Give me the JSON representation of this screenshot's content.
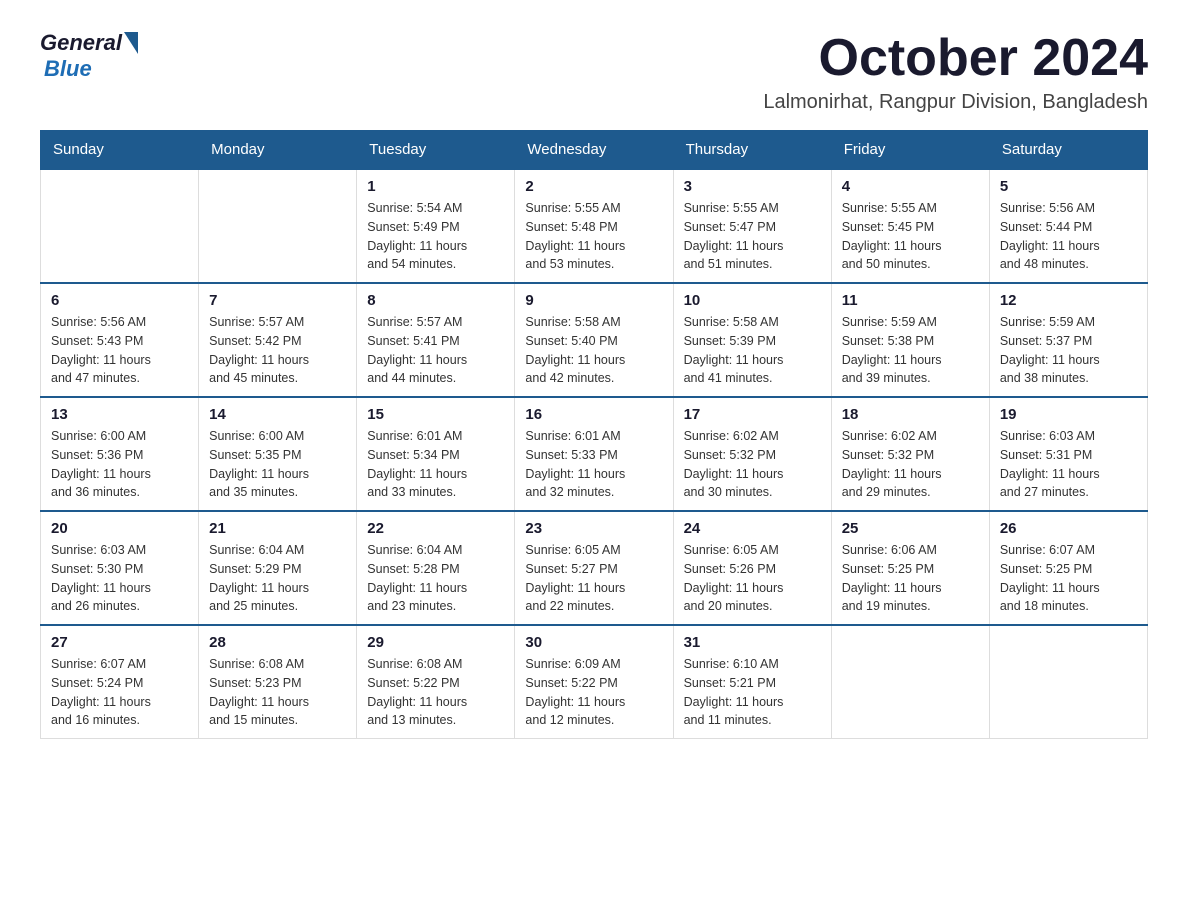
{
  "logo": {
    "text_general": "General",
    "text_blue": "Blue"
  },
  "header": {
    "month_year": "October 2024",
    "location": "Lalmonirhat, Rangpur Division, Bangladesh"
  },
  "weekdays": [
    "Sunday",
    "Monday",
    "Tuesday",
    "Wednesday",
    "Thursday",
    "Friday",
    "Saturday"
  ],
  "weeks": [
    [
      {
        "day": "",
        "info": ""
      },
      {
        "day": "",
        "info": ""
      },
      {
        "day": "1",
        "info": "Sunrise: 5:54 AM\nSunset: 5:49 PM\nDaylight: 11 hours\nand 54 minutes."
      },
      {
        "day": "2",
        "info": "Sunrise: 5:55 AM\nSunset: 5:48 PM\nDaylight: 11 hours\nand 53 minutes."
      },
      {
        "day": "3",
        "info": "Sunrise: 5:55 AM\nSunset: 5:47 PM\nDaylight: 11 hours\nand 51 minutes."
      },
      {
        "day": "4",
        "info": "Sunrise: 5:55 AM\nSunset: 5:45 PM\nDaylight: 11 hours\nand 50 minutes."
      },
      {
        "day": "5",
        "info": "Sunrise: 5:56 AM\nSunset: 5:44 PM\nDaylight: 11 hours\nand 48 minutes."
      }
    ],
    [
      {
        "day": "6",
        "info": "Sunrise: 5:56 AM\nSunset: 5:43 PM\nDaylight: 11 hours\nand 47 minutes."
      },
      {
        "day": "7",
        "info": "Sunrise: 5:57 AM\nSunset: 5:42 PM\nDaylight: 11 hours\nand 45 minutes."
      },
      {
        "day": "8",
        "info": "Sunrise: 5:57 AM\nSunset: 5:41 PM\nDaylight: 11 hours\nand 44 minutes."
      },
      {
        "day": "9",
        "info": "Sunrise: 5:58 AM\nSunset: 5:40 PM\nDaylight: 11 hours\nand 42 minutes."
      },
      {
        "day": "10",
        "info": "Sunrise: 5:58 AM\nSunset: 5:39 PM\nDaylight: 11 hours\nand 41 minutes."
      },
      {
        "day": "11",
        "info": "Sunrise: 5:59 AM\nSunset: 5:38 PM\nDaylight: 11 hours\nand 39 minutes."
      },
      {
        "day": "12",
        "info": "Sunrise: 5:59 AM\nSunset: 5:37 PM\nDaylight: 11 hours\nand 38 minutes."
      }
    ],
    [
      {
        "day": "13",
        "info": "Sunrise: 6:00 AM\nSunset: 5:36 PM\nDaylight: 11 hours\nand 36 minutes."
      },
      {
        "day": "14",
        "info": "Sunrise: 6:00 AM\nSunset: 5:35 PM\nDaylight: 11 hours\nand 35 minutes."
      },
      {
        "day": "15",
        "info": "Sunrise: 6:01 AM\nSunset: 5:34 PM\nDaylight: 11 hours\nand 33 minutes."
      },
      {
        "day": "16",
        "info": "Sunrise: 6:01 AM\nSunset: 5:33 PM\nDaylight: 11 hours\nand 32 minutes."
      },
      {
        "day": "17",
        "info": "Sunrise: 6:02 AM\nSunset: 5:32 PM\nDaylight: 11 hours\nand 30 minutes."
      },
      {
        "day": "18",
        "info": "Sunrise: 6:02 AM\nSunset: 5:32 PM\nDaylight: 11 hours\nand 29 minutes."
      },
      {
        "day": "19",
        "info": "Sunrise: 6:03 AM\nSunset: 5:31 PM\nDaylight: 11 hours\nand 27 minutes."
      }
    ],
    [
      {
        "day": "20",
        "info": "Sunrise: 6:03 AM\nSunset: 5:30 PM\nDaylight: 11 hours\nand 26 minutes."
      },
      {
        "day": "21",
        "info": "Sunrise: 6:04 AM\nSunset: 5:29 PM\nDaylight: 11 hours\nand 25 minutes."
      },
      {
        "day": "22",
        "info": "Sunrise: 6:04 AM\nSunset: 5:28 PM\nDaylight: 11 hours\nand 23 minutes."
      },
      {
        "day": "23",
        "info": "Sunrise: 6:05 AM\nSunset: 5:27 PM\nDaylight: 11 hours\nand 22 minutes."
      },
      {
        "day": "24",
        "info": "Sunrise: 6:05 AM\nSunset: 5:26 PM\nDaylight: 11 hours\nand 20 minutes."
      },
      {
        "day": "25",
        "info": "Sunrise: 6:06 AM\nSunset: 5:25 PM\nDaylight: 11 hours\nand 19 minutes."
      },
      {
        "day": "26",
        "info": "Sunrise: 6:07 AM\nSunset: 5:25 PM\nDaylight: 11 hours\nand 18 minutes."
      }
    ],
    [
      {
        "day": "27",
        "info": "Sunrise: 6:07 AM\nSunset: 5:24 PM\nDaylight: 11 hours\nand 16 minutes."
      },
      {
        "day": "28",
        "info": "Sunrise: 6:08 AM\nSunset: 5:23 PM\nDaylight: 11 hours\nand 15 minutes."
      },
      {
        "day": "29",
        "info": "Sunrise: 6:08 AM\nSunset: 5:22 PM\nDaylight: 11 hours\nand 13 minutes."
      },
      {
        "day": "30",
        "info": "Sunrise: 6:09 AM\nSunset: 5:22 PM\nDaylight: 11 hours\nand 12 minutes."
      },
      {
        "day": "31",
        "info": "Sunrise: 6:10 AM\nSunset: 5:21 PM\nDaylight: 11 hours\nand 11 minutes."
      },
      {
        "day": "",
        "info": ""
      },
      {
        "day": "",
        "info": ""
      }
    ]
  ]
}
